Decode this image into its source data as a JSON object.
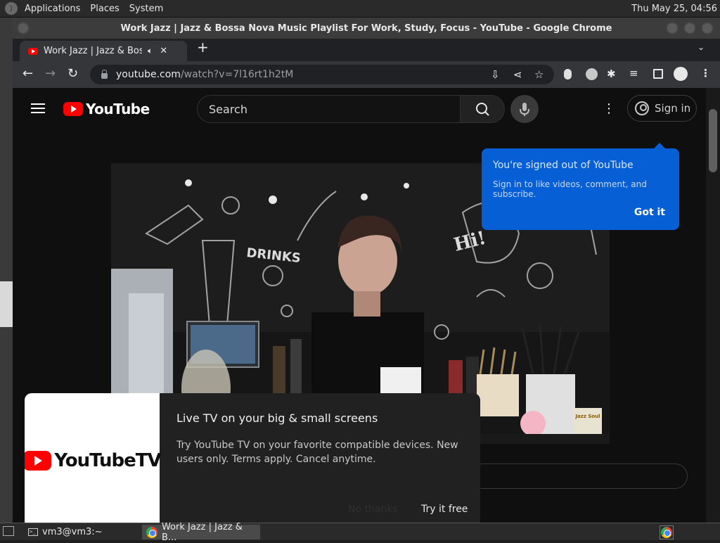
{
  "system_panel": {
    "menus": [
      "Applications",
      "Places",
      "System"
    ],
    "clock": "Thu May 25, 04:56"
  },
  "window": {
    "title": "Work Jazz | Jazz & Bossa Nova Music Playlist For Work, Study, Focus - YouTube - Google Chrome"
  },
  "tab": {
    "title": "Work Jazz | Jazz & Bossa Nova Music Playlist For Work, Study, Focus - YouTube",
    "close": "✕",
    "audio_icon": "speaker-icon"
  },
  "omnibox": {
    "url_host": "youtube.com",
    "url_path": "/watch?v=7l16rt1h2tM"
  },
  "youtube": {
    "logo_text": "YouTube",
    "search_placeholder": "Search",
    "signin_label": "Sign in",
    "callout": {
      "heading": "You're signed out of YouTube",
      "subtext": "Sign in to like videos, comment, and subscribe.",
      "action": "Got it"
    },
    "promo": {
      "logo_text": "YouTubeTV",
      "title": "Live TV on your big & small screens",
      "body": "Try YouTube TV on your favorite compatible devices. New users only. Terms apply. Cancel anytime.",
      "dismiss": "No thanks",
      "cta": "Try it free"
    },
    "video_overlay": {
      "chalk_word": "DRINKS",
      "speech_bubble": "Hi!",
      "channel_badge": "Jazz Soul"
    }
  },
  "taskbar": {
    "items": [
      {
        "label": "vm3@vm3:~",
        "icon": "terminal-icon"
      },
      {
        "label": "Work Jazz | Jazz & B...",
        "icon": "chrome-icon"
      }
    ]
  },
  "colors": {
    "yt_red": "#ff0000",
    "callout_blue": "#065fd4",
    "yt_bg": "#0f0f0f"
  }
}
